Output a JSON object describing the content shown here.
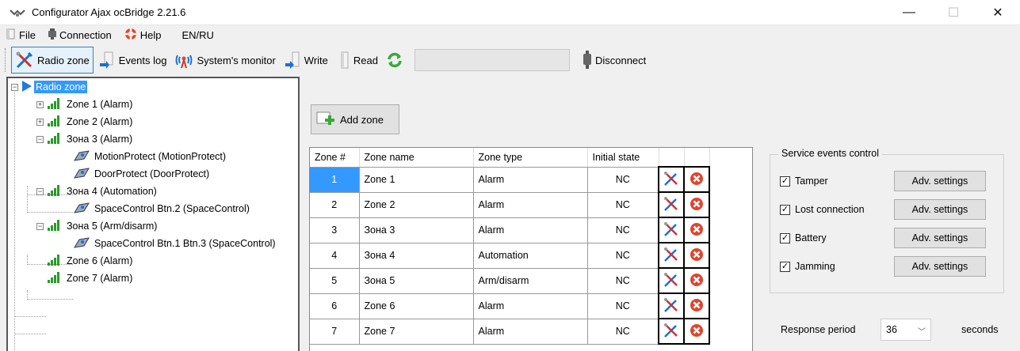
{
  "window": {
    "title": "Configurator Ajax ocBridge 2.21.6",
    "minimize": "—",
    "maximize": "☐",
    "close": "✕"
  },
  "menu": {
    "file": "File",
    "connection": "Connection",
    "help": "Help",
    "lang": "EN/RU"
  },
  "toolbar": {
    "radio_zone": "Radio zone",
    "events_log": "Events log",
    "systems_monitor": "System's monitor",
    "write": "Write",
    "read": "Read",
    "disconnect": "Disconnect"
  },
  "tree": {
    "root": "Radio zone",
    "items": [
      {
        "label": "Zone 1 (Alarm)"
      },
      {
        "label": "Zone 2 (Alarm)"
      },
      {
        "label": "Зона 3 (Alarm)"
      },
      {
        "label": "MotionProtect (MotionProtect)"
      },
      {
        "label": "DoorProtect (DoorProtect)"
      },
      {
        "label": "Зона 4 (Automation)"
      },
      {
        "label": "SpaceControl Btn.2 (SpaceControl)"
      },
      {
        "label": "Зона 5 (Arm/disarm)"
      },
      {
        "label": "SpaceControl Btn.1 Btn.3 (SpaceControl)"
      },
      {
        "label": "Zone 6 (Alarm)"
      },
      {
        "label": "Zone 7 (Alarm)"
      }
    ]
  },
  "add_zone": "Add zone",
  "grid": {
    "headers": [
      "Zone #",
      "Zone name",
      "Zone type",
      "Initial state"
    ],
    "rows": [
      {
        "num": "1",
        "name": "Zone 1",
        "type": "Alarm",
        "state": "NC"
      },
      {
        "num": "2",
        "name": "Zone 2",
        "type": "Alarm",
        "state": "NC"
      },
      {
        "num": "3",
        "name": "Зона 3",
        "type": "Alarm",
        "state": "NC"
      },
      {
        "num": "4",
        "name": "Зона 4",
        "type": "Automation",
        "state": "NC"
      },
      {
        "num": "5",
        "name": "Зона 5",
        "type": "Arm/disarm",
        "state": "NC"
      },
      {
        "num": "6",
        "name": "Zone 6",
        "type": "Alarm",
        "state": "NC"
      },
      {
        "num": "7",
        "name": "Zone 7",
        "type": "Alarm",
        "state": "NC"
      }
    ]
  },
  "service": {
    "legend": "Service events control",
    "items": [
      {
        "label": "Tamper",
        "button": "Adv. settings"
      },
      {
        "label": "Lost connection",
        "button": "Adv. settings"
      },
      {
        "label": "Battery",
        "button": "Adv. settings"
      },
      {
        "label": "Jamming",
        "button": "Adv. settings"
      }
    ]
  },
  "response": {
    "label": "Response period",
    "value": "36",
    "unit": "seconds"
  },
  "colors": {
    "selection": "#3399ff",
    "active_tool": "#e5f1fb"
  }
}
